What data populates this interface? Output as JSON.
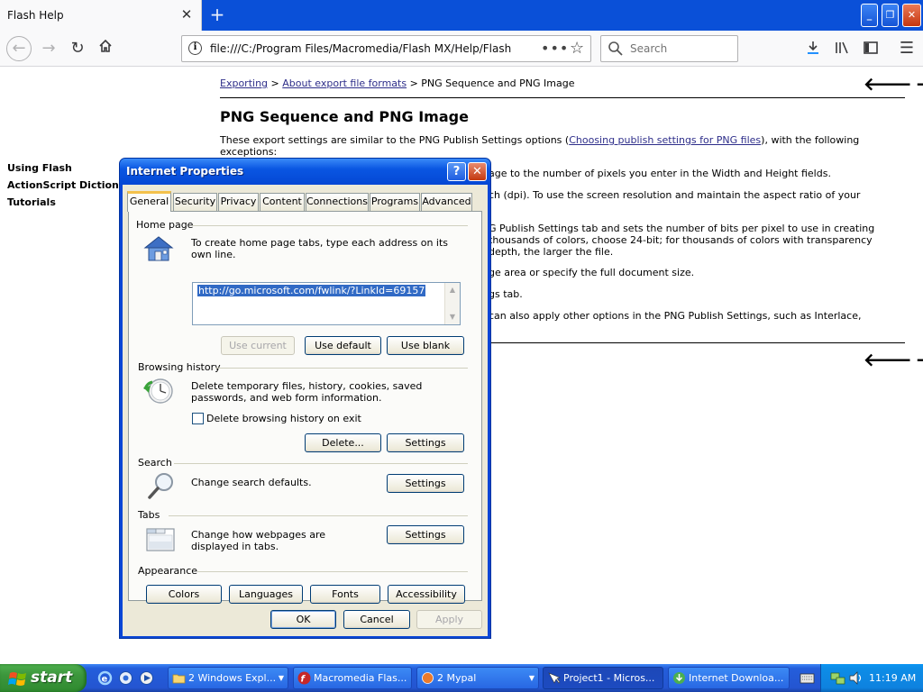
{
  "browser": {
    "tab_title": "Flash Help",
    "url": "file:///C:/Program Files/Macromedia/Flash MX/Help/Flash",
    "search_placeholder": "Search"
  },
  "page": {
    "left_nav": [
      "Using Flash",
      "ActionScript Diction",
      "Tutorials"
    ],
    "breadcrumb": {
      "link1": "Exporting",
      "sep": ">",
      "link2": "About export file formats",
      "current": "PNG Sequence and PNG Image"
    },
    "title": "PNG Sequence and PNG Image",
    "intro_before": "These export settings are similar to the PNG Publish Settings options (",
    "intro_link": "Choosing publish settings for PNG files",
    "intro_after": "), with the following exceptions:",
    "fragments": [
      "age to the number of pixels you enter in the Width and Height fields.",
      "ch (dpi). To use the screen resolution and maintain the aspect ratio of your",
      "G Publish Settings tab and sets the number of bits per pixel to use in creating",
      "thousands of colors, choose 24-bit; for thousands of colors with transparency",
      "depth, the larger the file.",
      "ge area or specify the full document size.",
      "gs tab.",
      "can also apply other options in the PNG Publish Settings, such as Interlace,"
    ]
  },
  "dialog": {
    "title": "Internet Properties",
    "tabs": [
      "General",
      "Security",
      "Privacy",
      "Content",
      "Connections",
      "Programs",
      "Advanced"
    ],
    "home_page": {
      "label": "Home page",
      "description": "To create home page tabs, type each address on its own line.",
      "url": "http://go.microsoft.com/fwlink/?LinkId=69157",
      "use_current": "Use current",
      "use_default": "Use default",
      "use_blank": "Use blank"
    },
    "browsing_history": {
      "label": "Browsing history",
      "description": "Delete temporary files, history, cookies, saved passwords, and web form information.",
      "checkbox_label": "Delete browsing history on exit",
      "checkbox_checked": false,
      "delete": "Delete...",
      "settings": "Settings"
    },
    "search": {
      "label": "Search",
      "description": "Change search defaults.",
      "settings": "Settings"
    },
    "tabs_section": {
      "label": "Tabs",
      "description": "Change how webpages are displayed in tabs.",
      "settings": "Settings"
    },
    "appearance": {
      "label": "Appearance",
      "colors": "Colors",
      "languages": "Languages",
      "fonts": "Fonts",
      "accessibility": "Accessibility"
    },
    "ok": "OK",
    "cancel": "Cancel",
    "apply": "Apply"
  },
  "taskbar": {
    "start": "start",
    "tasks": [
      {
        "label": "2 Windows Expl...",
        "dropdown": true
      },
      {
        "label": "Macromedia Flas...",
        "dropdown": false
      },
      {
        "label": "2 Mypal",
        "dropdown": true
      },
      {
        "label": "Project1 - Micros...",
        "dropdown": false
      },
      {
        "label": "Internet Downloa...",
        "dropdown": false
      }
    ],
    "clock": "11:19 AM"
  }
}
